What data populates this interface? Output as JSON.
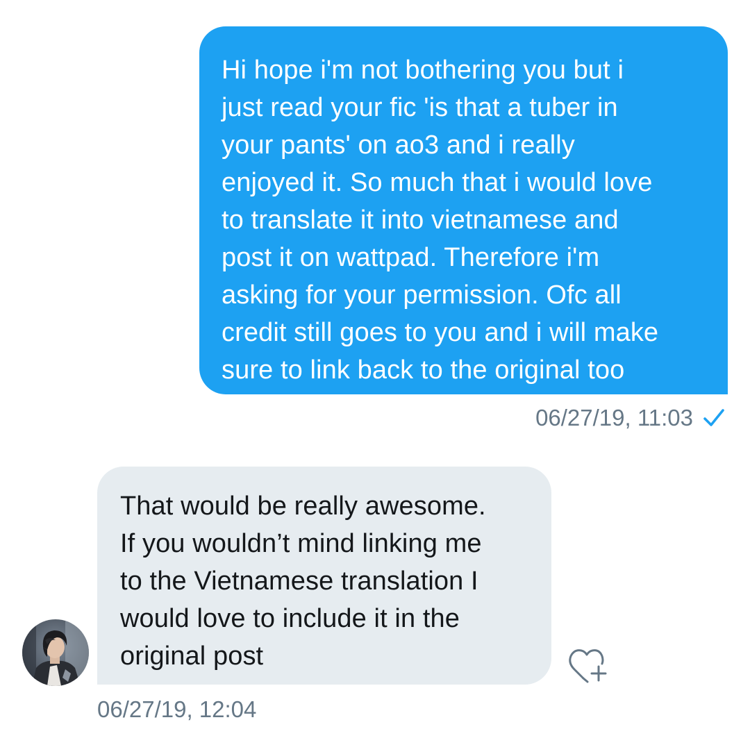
{
  "thread": {
    "outgoing": {
      "text": "Hi hope i'm not bothering you but i\njust read your fic 'is that a tuber in\nyour pants' on ao3 and i really\nenjoyed it. So much that i would love\nto translate it into vietnamese and\npost it on wattpad. Therefore i'm\nasking for your permission. Ofc all\ncredit still goes to you and i will make\nsure to link back to the original too",
      "timestamp": "06/27/19, 11:03",
      "status_icon": "check-icon"
    },
    "incoming": {
      "text": "That would be really awesome.\nIf you wouldn’t mind linking me\nto the Vietnamese translation I\nwould love to include it in the\noriginal post",
      "timestamp": "06/27/19, 12:04",
      "avatar_icon": "avatar",
      "reaction_icon": "heart-plus-icon"
    }
  },
  "colors": {
    "outgoing_bubble": "#1da1f2",
    "incoming_bubble": "#e6ecf0",
    "meta_text": "#657786",
    "accent": "#1da1f2"
  }
}
